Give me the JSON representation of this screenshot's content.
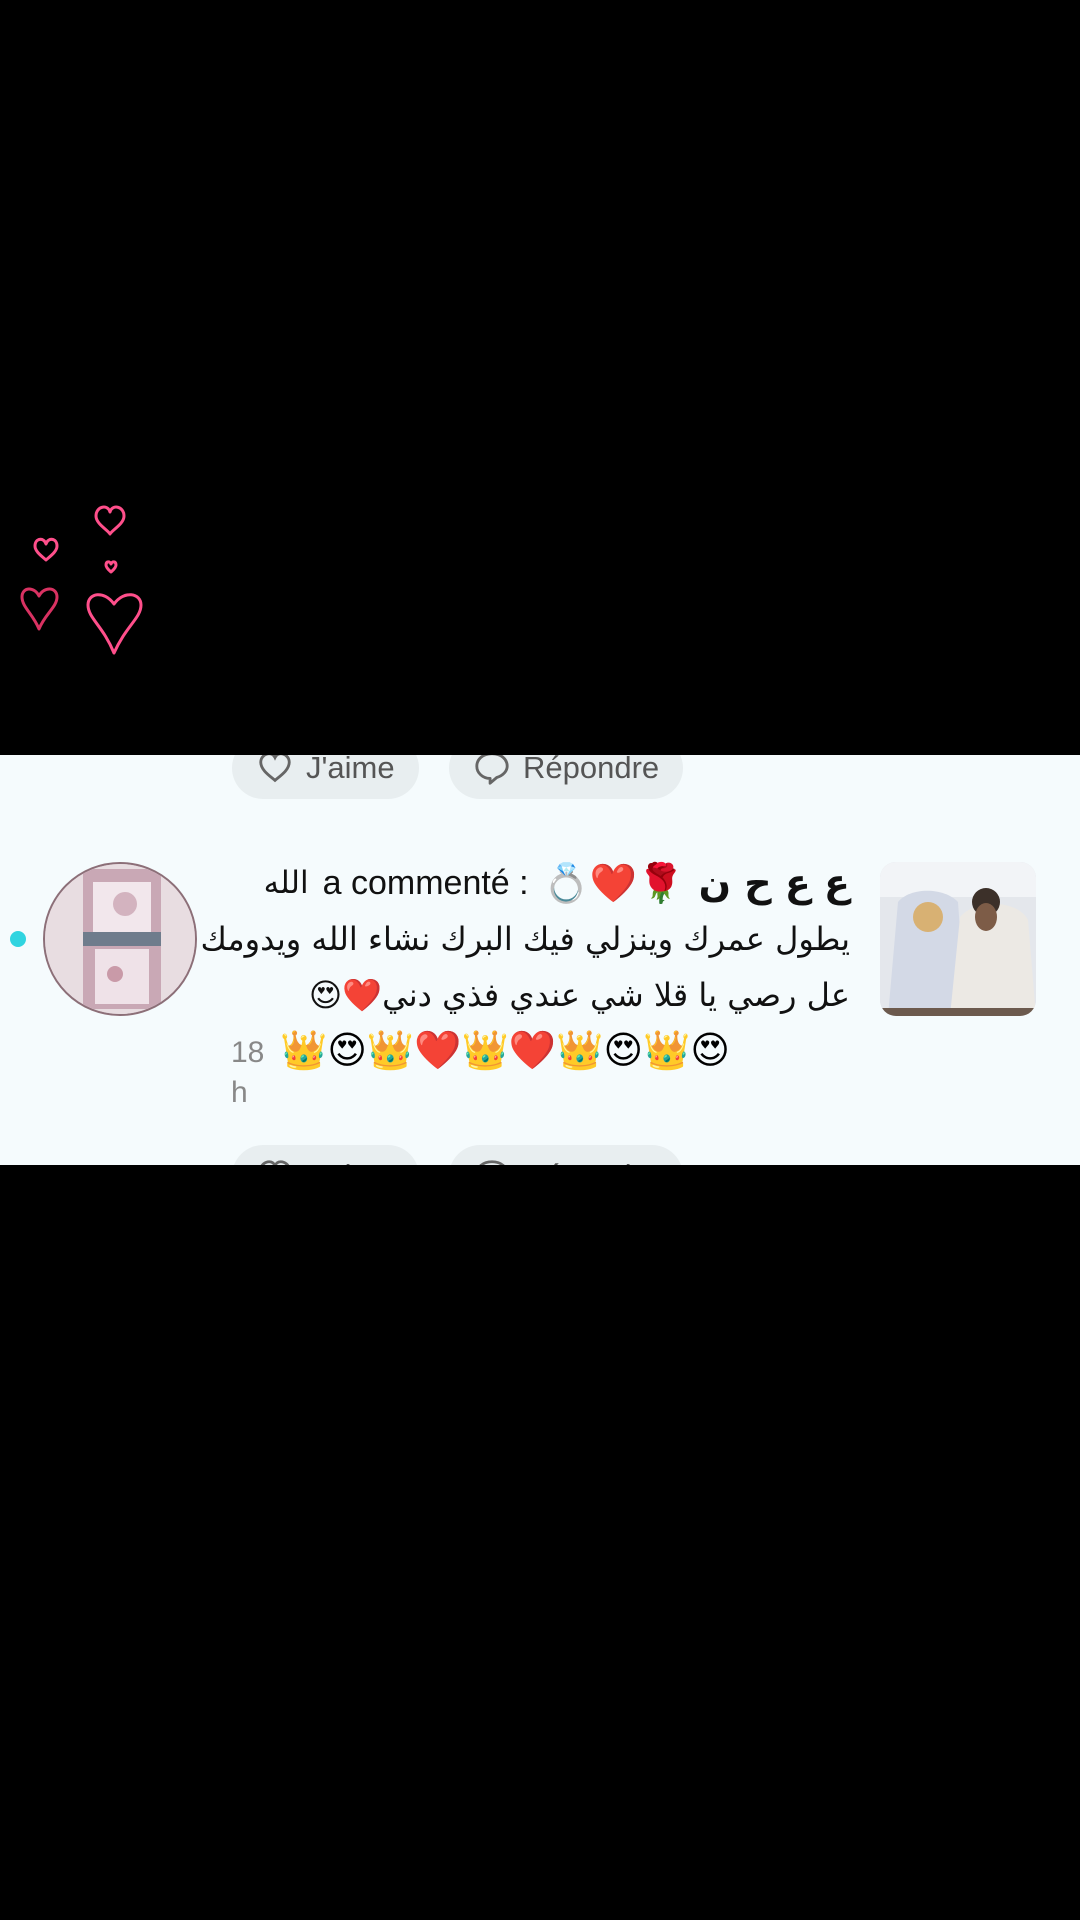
{
  "comment": {
    "author_name": "ع ع ح ن",
    "author_emojis": "🌹❤️💍",
    "action_text": "a commenté :",
    "line1_suffix": "الله",
    "line2": "يطول عمرك وينزلي فيك البرك نشاء الله ويدومك",
    "line3": "عل رصي يا قلا شي عندي فذي دني❤️😍",
    "line4_emojis": "👑😍👑❤️👑❤️👑😍👑😍",
    "time_number": "18",
    "time_unit": "h"
  },
  "actions": {
    "like_label": "J'aime",
    "reply_label": "Répondre"
  },
  "colors": {
    "panel_bg": "#f5fbfd",
    "button_bg": "#e8eef0",
    "online_dot": "#30d4e0",
    "heart_pink": "#ff4f8b"
  }
}
